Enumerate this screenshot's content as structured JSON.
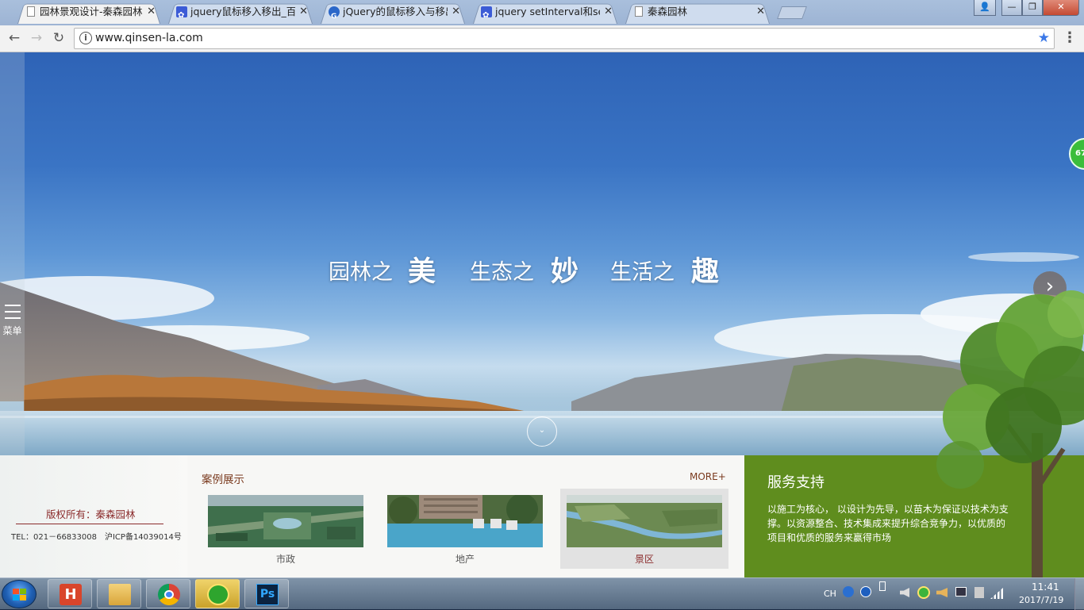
{
  "browser": {
    "tabs": [
      {
        "title": "园林景观设计-秦森园林",
        "icon": "doc-icon",
        "active": true
      },
      {
        "title": "jquery鼠标移入移出_百度",
        "icon": "baidu-paw-icon",
        "active": false
      },
      {
        "title": "jQuery的鼠标移入与移出",
        "icon": "globe-icon",
        "active": false
      },
      {
        "title": "jquery setInterval和set",
        "icon": "baidu-paw-icon",
        "active": false
      },
      {
        "title": "秦森园林",
        "icon": "doc-icon",
        "active": false
      }
    ],
    "tab_close": "✕",
    "url": "www.qinsen-la.com",
    "info_glyph": "i",
    "star_glyph": "★",
    "menu_glyph": "⋮",
    "window_buttons": {
      "user": "👤",
      "minimize": "—",
      "maximize": "❐",
      "close": "✕"
    },
    "nav": {
      "back": "←",
      "forward": "→",
      "reload": "↻"
    }
  },
  "site": {
    "menu_label": "菜单",
    "slogan": [
      {
        "prefix": "园林之",
        "emphasis": "美"
      },
      {
        "prefix": "生态之",
        "emphasis": "妙"
      },
      {
        "prefix": "生活之",
        "emphasis": "趣"
      }
    ],
    "next_arrow": "›",
    "scroll_glyph": "⌄",
    "widget_number": "67",
    "footer": {
      "copyright": "版权所有：秦森园林",
      "tel": "TEL：021－66833008　沪ICP备14039014号"
    },
    "cases": {
      "title": "案例展示",
      "more": "MORE+",
      "items": [
        {
          "label": "市政",
          "highlighted": false
        },
        {
          "label": "地产",
          "highlighted": false
        },
        {
          "label": "景区",
          "highlighted": true
        }
      ]
    },
    "service": {
      "title": "服务支持",
      "text": "以施工为核心， 以设计为先导，以苗木为保证以技术为支撑。以资源整合、技术集成来提升综合竞争力，以优质的项目和优质的服务来赢得市场"
    }
  },
  "taskbar": {
    "apps": [
      "hbuilder-icon",
      "file-explorer-icon",
      "chrome-icon",
      "360-security-icon",
      "photoshop-icon"
    ],
    "ps_label": "Ps",
    "hbuilder_label": "H",
    "tray_lang": "CH",
    "time": "11:41",
    "date": "2017/7/19"
  },
  "colors": {
    "service_green": "#5f8d1e",
    "accent_red": "#8b2c2c",
    "chrome_star": "#3b78e7"
  }
}
